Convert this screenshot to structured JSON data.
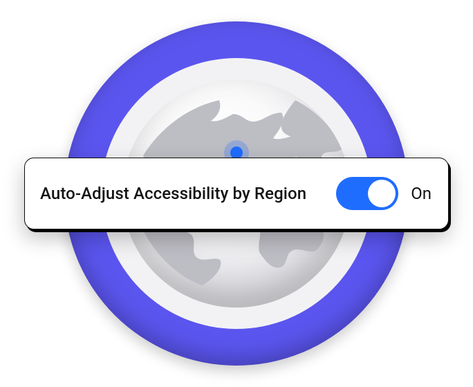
{
  "setting": {
    "label": "Auto-Adjust Accessibility by Region",
    "state_text": "On",
    "enabled": true
  },
  "colors": {
    "ring": "#5b55ef",
    "accent": "#1f6dff"
  }
}
